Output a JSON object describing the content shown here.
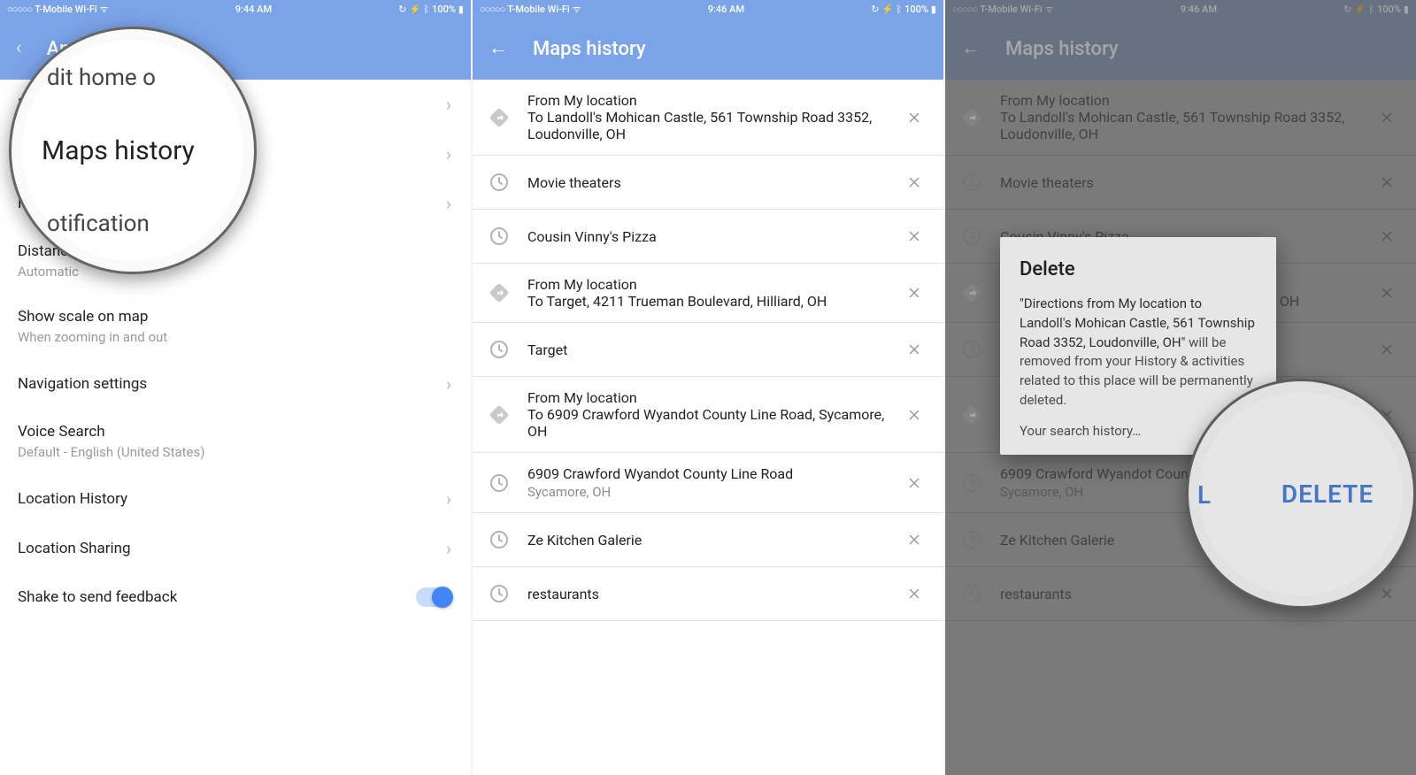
{
  "status": {
    "carrier": "T-Mobile Wi-Fi",
    "dots": "○○○○○",
    "battery": "100%",
    "icons": "↻ ⚡ ᛒ"
  },
  "times": {
    "s1": "9:44 AM",
    "s2": "9:46 AM",
    "s3": "9:46 AM"
  },
  "screen1": {
    "header": "App Settings",
    "back": "‹",
    "items": [
      {
        "title": "Edit home or work",
        "sub": "",
        "chev": true
      },
      {
        "title": "Maps history",
        "sub": "",
        "chev": true
      },
      {
        "title": "Notifications",
        "sub": "",
        "chev": true
      },
      {
        "title": "Distance units",
        "sub": "Automatic",
        "chev": false
      },
      {
        "title": "Show scale on map",
        "sub": "When zooming in and out",
        "chev": false
      },
      {
        "title": "Navigation settings",
        "sub": "",
        "chev": true
      },
      {
        "title": "Voice Search",
        "sub": "Default - English (United States)",
        "chev": false
      },
      {
        "title": "Location History",
        "sub": "",
        "chev": true
      },
      {
        "title": "Location Sharing",
        "sub": "",
        "chev": true
      },
      {
        "title": "Shake to send feedback",
        "sub": "",
        "toggle": true
      }
    ],
    "magnifier": {
      "faint_top": "dit home o",
      "main": "Maps history",
      "faint_bot": "otification"
    }
  },
  "screen2": {
    "header": "Maps history",
    "back_icon": "←",
    "items": [
      {
        "type": "dir",
        "line1": "From My location",
        "line2": "To Landoll's Mohican Castle, 561 Township Road 3352, Loudonville, OH"
      },
      {
        "type": "clock",
        "line1": "Movie theaters",
        "line2": ""
      },
      {
        "type": "clock",
        "line1": "Cousin Vinny's Pizza",
        "line2": ""
      },
      {
        "type": "dir",
        "line1": "From My location",
        "line2": "To Target, 4211 Trueman Boulevard, Hilliard, OH"
      },
      {
        "type": "clock",
        "line1": "Target",
        "line2": ""
      },
      {
        "type": "dir",
        "line1": "From My location",
        "line2": "To 6909 Crawford Wyandot County Line Road, Sycamore, OH"
      },
      {
        "type": "clock",
        "line1": "6909 Crawford Wyandot County Line Road",
        "sub": "Sycamore, OH"
      },
      {
        "type": "clock",
        "line1": "Ze Kitchen Galerie",
        "line2": ""
      },
      {
        "type": "clock",
        "line1": "restaurants",
        "line2": ""
      }
    ],
    "magnifier": {
      "x": "✕",
      "tiny": "H"
    }
  },
  "screen3": {
    "header": "Maps history",
    "back_icon": "←",
    "dialog": {
      "title": "Delete",
      "body_quote": "\"Directions from My location to Landoll's Mohican Castle, 561 Township Road 3352, Loudonville, OH\"",
      "body_rest": " will be removed from your History & activities related to this place will be permanently deleted.",
      "sub": "Your search history…",
      "cancel": "CANCEL",
      "delete": "DELETE"
    },
    "magnifier_delete": "DELETE",
    "magnifier_cancel_frag": "L"
  }
}
